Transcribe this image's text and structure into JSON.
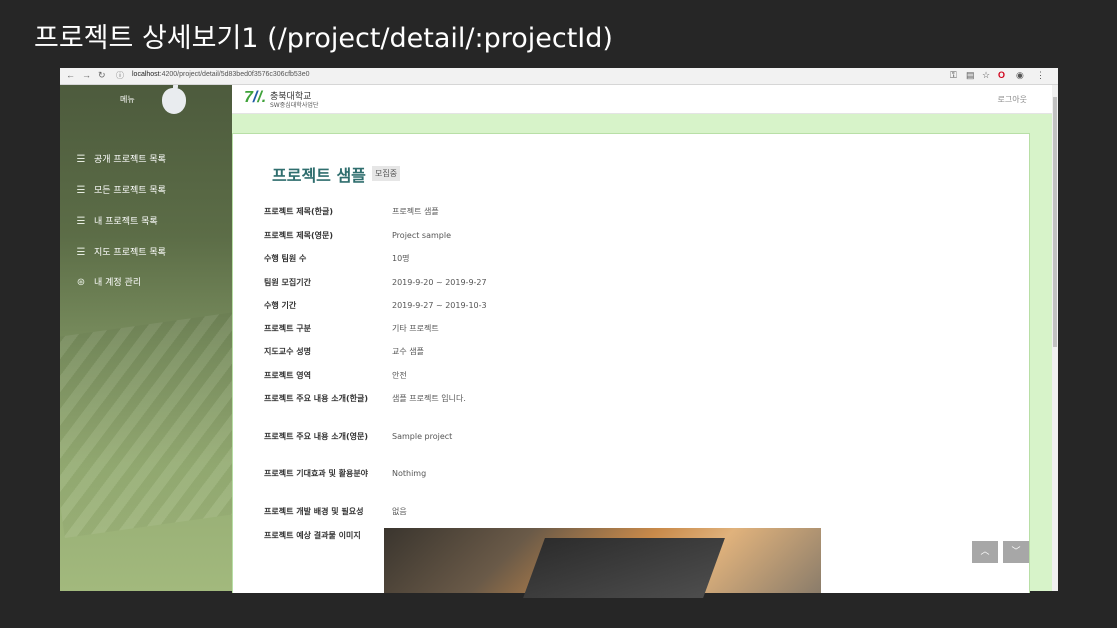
{
  "slide_title": "프로젝트 상세보기1 (/project/detail/:projectId)",
  "browser": {
    "url_host": "localhost",
    "url_rest": ":4200/project/detail/5d83bed0f3576c306cfb53e0"
  },
  "sidebar": {
    "menu_title": "메뉴",
    "items": [
      {
        "label": "공개 프로젝트 목록",
        "icon": "list-icon"
      },
      {
        "label": "모든 프로젝트 목록",
        "icon": "list-icon"
      },
      {
        "label": "내 프로젝트 목록",
        "icon": "list-icon"
      },
      {
        "label": "지도 프로젝트 목록",
        "icon": "list-icon"
      },
      {
        "label": "내 계정 관리",
        "icon": "user-icon"
      }
    ]
  },
  "header": {
    "logo_line1": "충북대학교",
    "logo_line2": "SW중심대학사업단",
    "logout": "로그아웃"
  },
  "project": {
    "title": "프로젝트 샘플",
    "status": "모집중",
    "fields": [
      {
        "label": "프로젝트 제목(한글)",
        "value": "프로젝트 샘플"
      },
      {
        "label": "프로젝트 제목(영문)",
        "value": "Project sample"
      },
      {
        "label": "수행 팀원 수",
        "value": "10명"
      },
      {
        "label": "팀원 모집기간",
        "value": "2019-9-20 ~ 2019-9-27"
      },
      {
        "label": "수행 기간",
        "value": "2019-9-27 ~ 2019-10-3"
      },
      {
        "label": "프로젝트 구분",
        "value": "기타 프로젝트"
      },
      {
        "label": "지도교수 성명",
        "value": "교수 샘플"
      },
      {
        "label": "프로젝트 영역",
        "value": "안전"
      },
      {
        "label": "프로젝트 주요 내용 소개(한글)",
        "value": "샘플 프로젝트 입니다."
      },
      {
        "label": "프로젝트 주요 내용 소개(영문)",
        "value": "Sample project"
      },
      {
        "label": "프로젝트 기대효과 및 활용분야",
        "value": "Nothimg"
      },
      {
        "label": "프로젝트 개발 배경 및 필요성",
        "value": "없음"
      },
      {
        "label": "프로젝트 예상 결과물 이미지",
        "value": ""
      }
    ]
  },
  "page_buttons": {
    "up": "︿",
    "down": "﹀"
  }
}
